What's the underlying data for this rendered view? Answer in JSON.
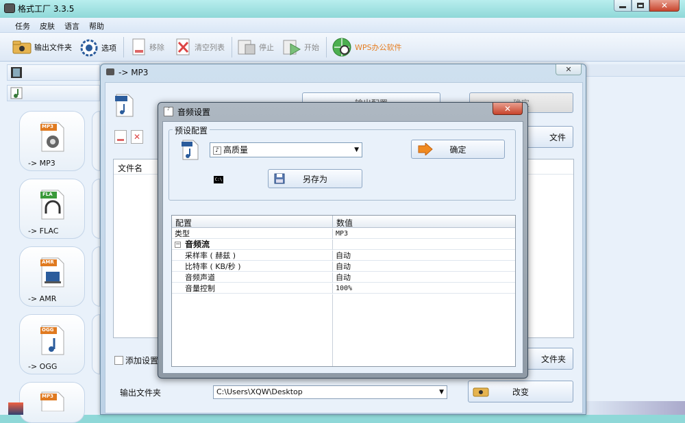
{
  "main_window": {
    "title": "格式工厂 3.3.5",
    "menu": [
      "任务",
      "皮肤",
      "语言",
      "帮助"
    ],
    "toolbar": {
      "output_folder": "输出文件夹",
      "options": "选项",
      "remove": "移除",
      "clear_list": "清空列表",
      "stop": "停止",
      "start": "开始",
      "wps": "WPS办公软件"
    },
    "formats": [
      {
        "badge": "MP3",
        "label": "-> MP3",
        "color": "#e07a20"
      },
      {
        "badge": "FLA",
        "label": "-> FLAC",
        "color": "#3a9a3a"
      },
      {
        "badge": "AMR",
        "label": "-> AMR",
        "color": "#e07a20"
      },
      {
        "badge": "OGG",
        "label": "-> OGG",
        "color": "#e07a20"
      },
      {
        "badge": "MP3",
        "label": "",
        "color": "#e07a20"
      }
    ]
  },
  "mp3_dialog": {
    "title": "-> MP3",
    "output_config_button": "输出配置",
    "ok_button": "确定",
    "add_file_button": "文件",
    "filename_header": "文件名",
    "add_settings_checkbox": "添加设置",
    "output_folder_label": "输出文件夹",
    "output_folder_value": "C:\\Users\\XQW\\Desktop",
    "add_folder_button": "文件夹",
    "change_button": "改变"
  },
  "audio_dialog": {
    "title": "音频设置",
    "preset_group": "预设配置",
    "preset_value": "高质量",
    "ok_button": "确定",
    "save_as_button": "另存为",
    "cmd_icon_text": "C:\\",
    "table_headers": [
      "配置",
      "数值"
    ],
    "rows": [
      {
        "name": "类型",
        "value": "MP3",
        "level": 0
      },
      {
        "name": "音频流",
        "value": "",
        "level": 0,
        "group": true
      },
      {
        "name": "采样率 ( 赫兹 )",
        "value": "自动",
        "level": 1
      },
      {
        "name": "比特率 ( KB/秒 )",
        "value": "自动",
        "level": 1
      },
      {
        "name": "音频声道",
        "value": "自动",
        "level": 1
      },
      {
        "name": "音量控制",
        "value": "100%",
        "level": 1
      }
    ]
  },
  "colors": {
    "accent": "#2b6cb0",
    "titlebar": "#9fe0e0",
    "wps_orange": "#e67e22",
    "close_red": "#c9302c"
  }
}
